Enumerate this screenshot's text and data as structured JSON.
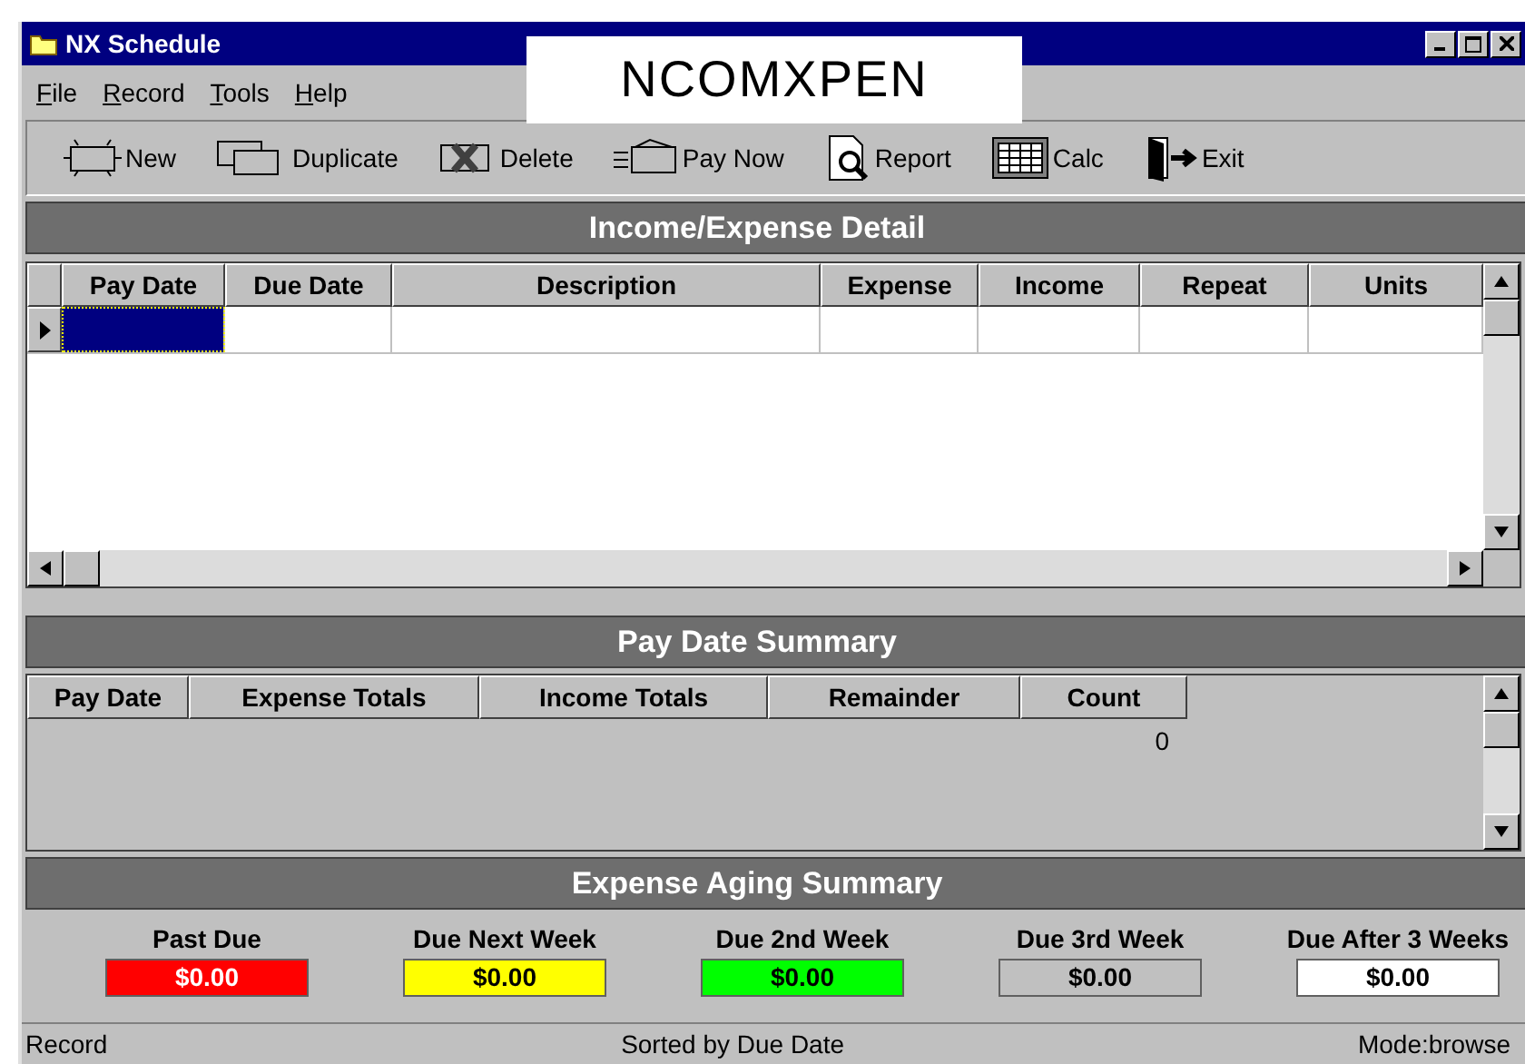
{
  "window": {
    "title": "NX Schedule",
    "banner": "NCOMXPEN"
  },
  "menu": [
    "File",
    "Record",
    "Tools",
    "Help"
  ],
  "toolbar": [
    {
      "kind": "new",
      "label": "New"
    },
    {
      "kind": "duplicate",
      "label": "Duplicate"
    },
    {
      "kind": "delete",
      "label": "Delete"
    },
    {
      "kind": "paynow",
      "label": "Pay Now"
    },
    {
      "kind": "report",
      "label": "Report"
    },
    {
      "kind": "calc",
      "label": "Calc"
    },
    {
      "kind": "exit",
      "label": "Exit"
    }
  ],
  "detail": {
    "title": "Income/Expense Detail",
    "columns": [
      "Pay Date",
      "Due Date",
      "Description",
      "Expense",
      "Income",
      "Repeat",
      "Units"
    ],
    "new_row": {
      "current": true
    }
  },
  "pay_summary": {
    "title": "Pay Date Summary",
    "columns": [
      "Pay Date",
      "Expense Totals",
      "Income Totals",
      "Remainder",
      "Count"
    ],
    "rows": [
      {
        "count": "0"
      }
    ]
  },
  "aging": {
    "title": "Expense Aging Summary",
    "items": [
      {
        "label": "Past Due",
        "value": "$0.00",
        "color": "#ff0000"
      },
      {
        "label": "Due Next Week",
        "value": "$0.00",
        "color": "#ffff00"
      },
      {
        "label": "Due 2nd Week",
        "value": "$0.00",
        "color": "#00ff00"
      },
      {
        "label": "Due 3rd Week",
        "value": "$0.00",
        "color": "#c0c0c0"
      },
      {
        "label": "Due After 3 Weeks",
        "value": "$0.00",
        "color": "#ffffff"
      }
    ]
  },
  "status_bar": [
    "Record",
    "Sorted by Due Date",
    "Mode:browse"
  ]
}
